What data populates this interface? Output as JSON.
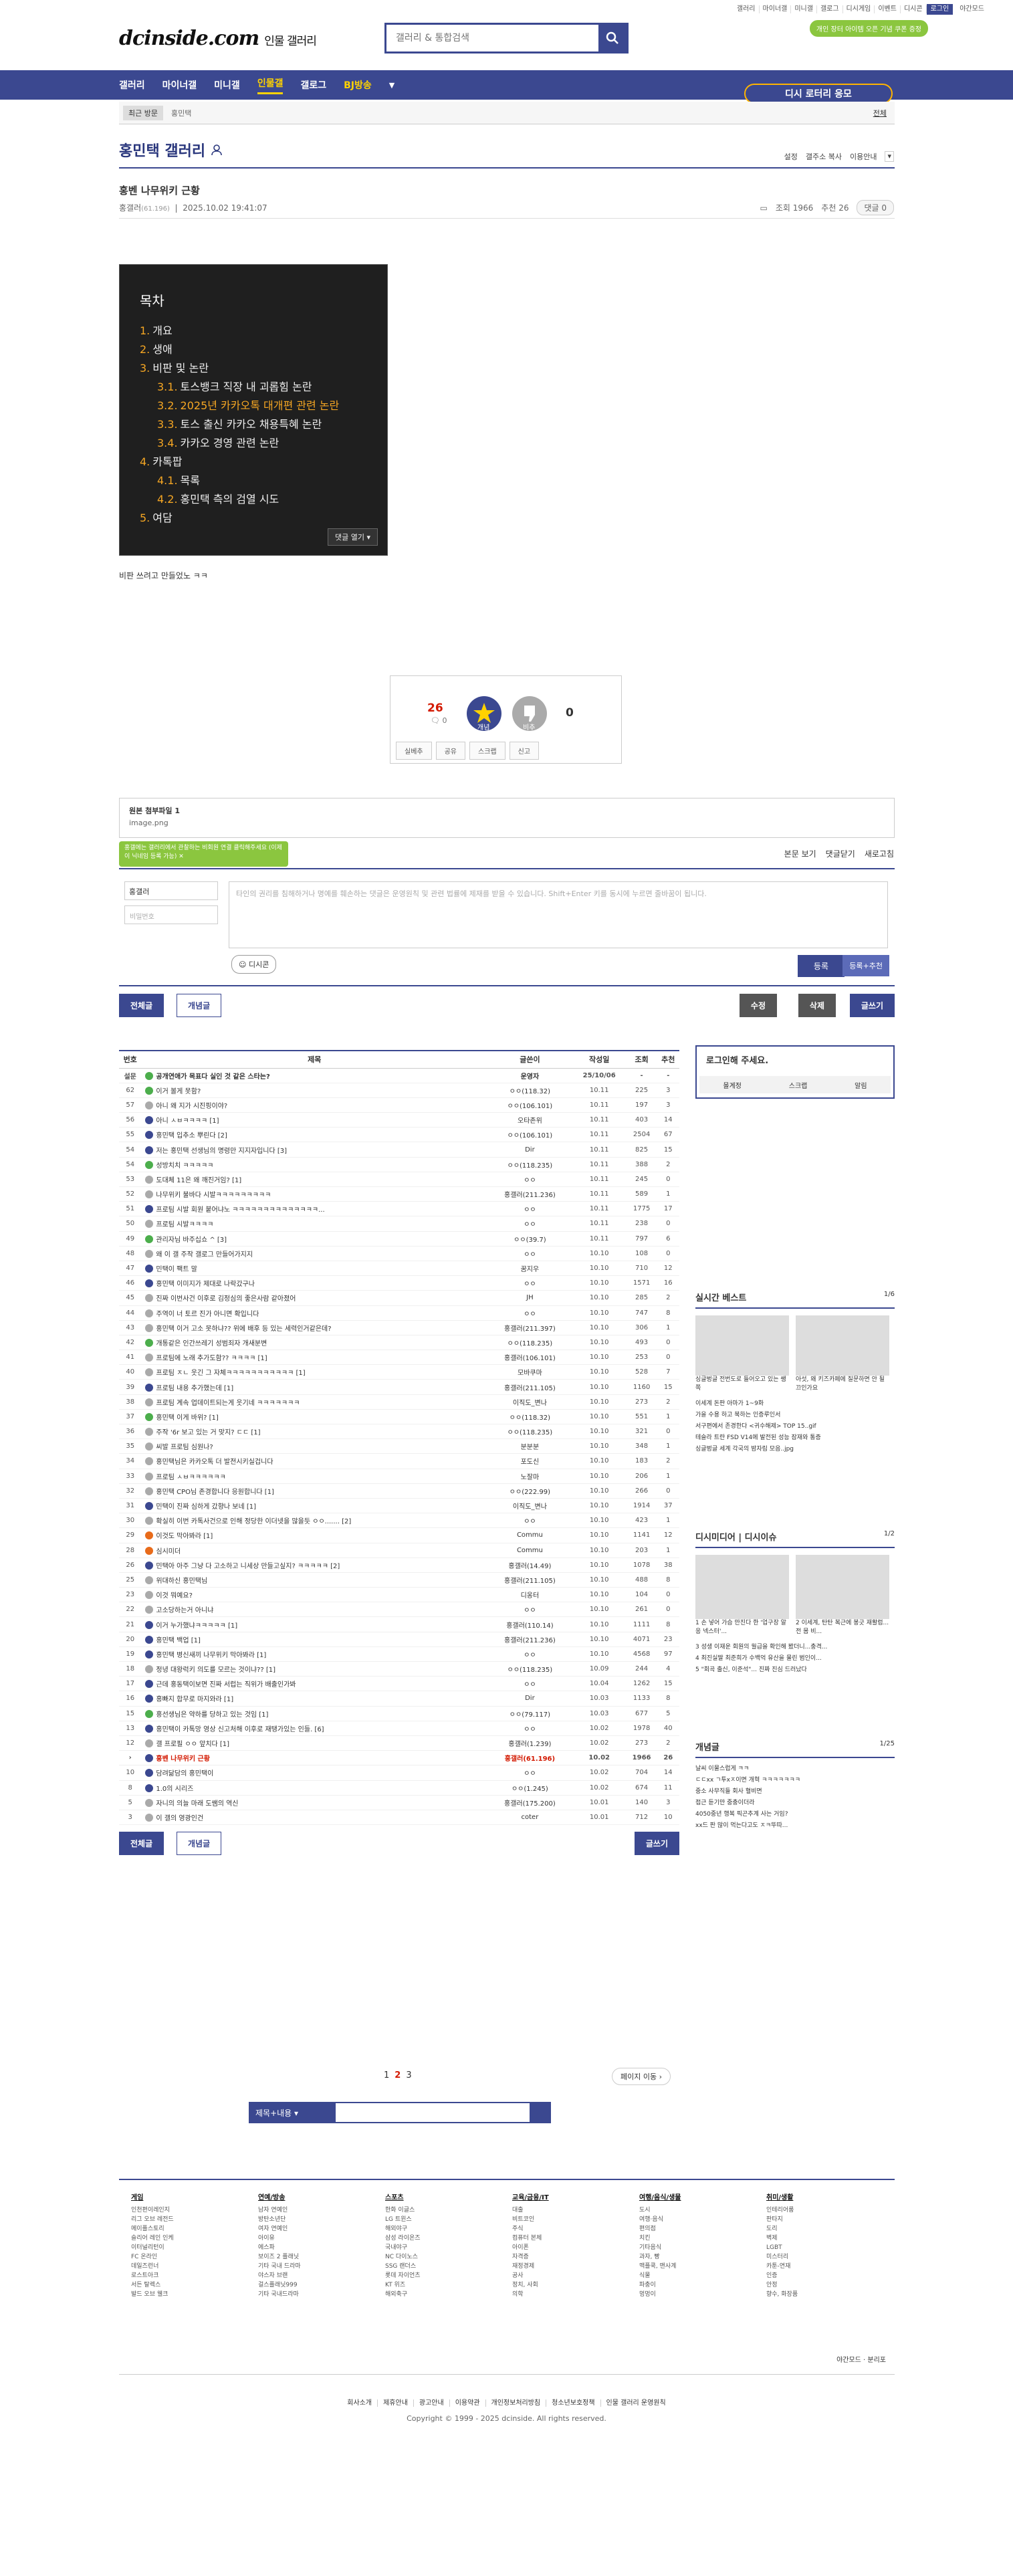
{
  "util": [
    "갤러리",
    "마이너갤",
    "미니갤",
    "갤로그",
    "디시게임",
    "이벤트",
    "디시콘",
    "로그인",
    "야간모드"
  ],
  "logo": {
    "main": "dcinside.com",
    "sub": "인물 갤러리"
  },
  "search": {
    "placeholder": "갤러리 & 통합검색"
  },
  "promo": "개인 장터 아이템 오픈 기념 쿠폰 증정",
  "nav": [
    "갤러리",
    "마이너갤",
    "미니갤",
    "인물갤",
    "갤로그",
    "BJ방송"
  ],
  "dcsi": "디시 로터리 응모",
  "recent": {
    "tag": "최근 방문",
    "item": "홍민택",
    "all": "전체"
  },
  "gallery": {
    "title": "홍민택 갤러리",
    "menu": [
      "설정",
      "갤주소 복사",
      "이용안내"
    ]
  },
  "post": {
    "title": "홍벤 나무위키 근황",
    "author": "홍갤러",
    "ip": "(61.196)",
    "date": "2025.10.02 19:41:07",
    "views": "조회 1966",
    "rec": "추천 26",
    "comments": "댓글 0"
  },
  "toc": {
    "title": "목차",
    "items": [
      {
        "n": "1.",
        "t": "개요",
        "l": 1
      },
      {
        "n": "2.",
        "t": "생애",
        "l": 1
      },
      {
        "n": "3.",
        "t": "비판 및 논란",
        "l": 1
      },
      {
        "n": "3.1.",
        "t": "토스뱅크 직장 내 괴롭힘 논란",
        "l": 2
      },
      {
        "n": "3.2.",
        "t": "2025년 카카오톡 대개편 관련 논란",
        "l": 2
      },
      {
        "n": "3.3.",
        "t": "토스 출신 카카오 채용특혜 논란",
        "l": 2
      },
      {
        "n": "3.4.",
        "t": "카카오 경영 관련 논란",
        "l": 2
      },
      {
        "n": "4.",
        "t": "카톡팝",
        "l": 1
      },
      {
        "n": "4.1.",
        "t": "목록",
        "l": 2
      },
      {
        "n": "4.2.",
        "t": "홍민택 측의 검열 시도",
        "l": 2
      },
      {
        "n": "5.",
        "t": "여담",
        "l": 1
      }
    ],
    "button": "댓글 열기"
  },
  "body": "비판 쓰려고 만들었노 ㅋㅋ",
  "vote": {
    "up": "26",
    "upsub": "0",
    "down": "0",
    "uplabel": "개념",
    "downlabel": "비추",
    "btns": [
      "실베추",
      "공유",
      "스크랩",
      "신고"
    ]
  },
  "attach": {
    "title": "원본 첨부파일 1",
    "file": "image.png"
  },
  "toast": "홍갤에는 갤러리에서 관찰하는 비회원 연결 클릭해주세요 (이제 이 닉네임 등록 가능)",
  "comment": {
    "bar": [
      "본문 보기",
      "댓글닫기",
      "새로고침"
    ],
    "user": "홍갤러",
    "pw": "비밀번호",
    "placeholder": "타인의 권리를 침해하거나 명예를 훼손하는 댓글은 운영원칙 및 관련 법률에 제재를 받을 수 있습니다. Shift+Enter 키를 동시에 누르면 줄바꿈이 됩니다.",
    "dccon": "디시콘",
    "submit": "등록",
    "submit2": "등록+추천"
  },
  "btns": {
    "all": "전체글",
    "best": "개념글",
    "edit": "수정",
    "del": "삭제",
    "write": "글쓰기"
  },
  "list": {
    "headers": [
      "번호",
      "제목",
      "글쓴이",
      "작성일",
      "조회",
      "추천"
    ],
    "rows": [
      {
        "no": "설문",
        "t": "공개연애가 목표다 실인 것 같은 스타는?",
        "w": "운영자",
        "d": "25/10/06",
        "v": "-",
        "r": "-",
        "ic": "g",
        "notice": true
      },
      {
        "no": "62",
        "t": "이거 볼게 못함?",
        "w": "ㅇㅇ(118.32)",
        "d": "10.11",
        "v": "225",
        "r": "3",
        "ic": "g"
      },
      {
        "no": "57",
        "t": "아니 왜 지가 시진핑이야?",
        "w": "ㅇㅇ(106.101)",
        "d": "10.11",
        "v": "197",
        "r": "3",
        "ic": "gr"
      },
      {
        "no": "56",
        "t": "아니 ㅅㅂㅋㅋㅋㅋ [1]",
        "w": "오타존위",
        "d": "10.11",
        "v": "403",
        "r": "14",
        "ic": "b"
      },
      {
        "no": "55",
        "t": "홍민택 입추소 뿌린다 [2]",
        "w": "ㅇㅇ(106.101)",
        "d": "10.11",
        "v": "2504",
        "r": "67",
        "ic": "b"
      },
      {
        "no": "54",
        "t": "저는 홍민택 선생님의 명령만 지지자입니다 [3]",
        "w": "Dir",
        "d": "10.11",
        "v": "825",
        "r": "15",
        "ic": "b"
      },
      {
        "no": "54",
        "t": "성방치치 ㅋㅋㅋㅋㅋ",
        "w": "ㅇㅇ(118.235)",
        "d": "10.11",
        "v": "388",
        "r": "2",
        "ic": "g"
      },
      {
        "no": "53",
        "t": "도대체 11은 왜 깨진거임? [1]",
        "w": "ㅇㅇ",
        "d": "10.11",
        "v": "245",
        "r": "0",
        "ic": "gr"
      },
      {
        "no": "52",
        "t": "나무위키 불바다 시발ㅋㅋㅋㅋㅋㅋㅋㅋㅋ",
        "w": "홍갤러(211.236)",
        "d": "10.11",
        "v": "589",
        "r": "1",
        "ic": "gr"
      },
      {
        "no": "51",
        "t": "프로팀 시발 회원 붙어냐노 ㅋㅋㅋㅋㅋㅋㅋㅋㅋㅋㅋㅋㅋㅋ...",
        "w": "ㅇㅇ",
        "d": "10.11",
        "v": "1775",
        "r": "17",
        "ic": "b"
      },
      {
        "no": "50",
        "t": "프로팀 시발ㅋㅋㅋㅋ",
        "w": "ㅇㅇ",
        "d": "10.11",
        "v": "238",
        "r": "0",
        "ic": "gr"
      },
      {
        "no": "49",
        "t": "관리자님 바주십쇼 ^ [3]",
        "w": "ㅇㅇ(39.7)",
        "d": "10.11",
        "v": "797",
        "r": "6",
        "ic": "g"
      },
      {
        "no": "48",
        "t": "왜 이 갤 주작 갤로그 만들어가지지",
        "w": "ㅇㅇ",
        "d": "10.10",
        "v": "108",
        "r": "0",
        "ic": "gr"
      },
      {
        "no": "47",
        "t": "민택이 팩트 말",
        "w": "꿈지우",
        "d": "10.10",
        "v": "710",
        "r": "12",
        "ic": "b"
      },
      {
        "no": "46",
        "t": "홍민택 이미지가 제대로 나락갔구나",
        "w": "ㅇㅇ",
        "d": "10.10",
        "v": "1571",
        "r": "16",
        "ic": "b"
      },
      {
        "no": "45",
        "t": "진짜 이번사건 이후로 김정심의 좋은사람 같아졌어",
        "w": "JH",
        "d": "10.10",
        "v": "285",
        "r": "2",
        "ic": "gr"
      },
      {
        "no": "44",
        "t": "주역이 너 토르 진가 아니면 확입니다",
        "w": "ㅇㅇ",
        "d": "10.10",
        "v": "747",
        "r": "8",
        "ic": "gr"
      },
      {
        "no": "43",
        "t": "홍민택 이거 고소 못하냐?? 위에 배후 등 있는 세력인거같은데?",
        "w": "홍갤러(211.397)",
        "d": "10.10",
        "v": "306",
        "r": "1",
        "ic": "gr"
      },
      {
        "no": "42",
        "t": "개통같은 인간쓰레기 성범죄자 개새분변",
        "w": "ㅇㅇ(118.235)",
        "d": "10.10",
        "v": "493",
        "r": "0",
        "ic": "g"
      },
      {
        "no": "41",
        "t": "프로팀에 노래 추가도함?? ㅋㅋㅋㅋ [1]",
        "w": "홍갤러(106.101)",
        "d": "10.10",
        "v": "253",
        "r": "0",
        "ic": "gr"
      },
      {
        "no": "40",
        "t": "프로팀 ㅈㄴ 웃긴 그 자체ㅋㅋㅋㅋㅋㅋㅋㅋㅋㅋㅋ [1]",
        "w": "모바쿠마",
        "d": "10.10",
        "v": "528",
        "r": "7",
        "ic": "gr"
      },
      {
        "no": "39",
        "t": "프로팀 내용 추가했는데 [1]",
        "w": "홍갤러(211.105)",
        "d": "10.10",
        "v": "1160",
        "r": "15",
        "ic": "b"
      },
      {
        "no": "38",
        "t": "프로팀 계속 업데이트되는게 웃기네 ㅋㅋㅋㅋㅋㅋㅋ",
        "w": "이직도_변나",
        "d": "10.10",
        "v": "273",
        "r": "2",
        "ic": "gr"
      },
      {
        "no": "37",
        "t": "홍민택 이게 바위? [1]",
        "w": "ㅇㅇ(118.32)",
        "d": "10.10",
        "v": "551",
        "r": "1",
        "ic": "g"
      },
      {
        "no": "36",
        "t": "주작 '6r 보고 있는 거 맞지? ㄷㄷ [1]",
        "w": "ㅇㅇ(118.235)",
        "d": "10.10",
        "v": "321",
        "r": "0",
        "ic": "gr"
      },
      {
        "no": "35",
        "t": "씨발 프로팀 심원나?",
        "w": "분분분",
        "d": "10.10",
        "v": "348",
        "r": "1",
        "ic": "gr"
      },
      {
        "no": "34",
        "t": "홍민택님은 카카오톡 더 발전시키실겁니다",
        "w": "포도신",
        "d": "10.10",
        "v": "183",
        "r": "2",
        "ic": "gr"
      },
      {
        "no": "33",
        "t": "프로팀 ㅅㅂㅋㅋㅋㅋㅋㅋ",
        "w": "노잘마",
        "d": "10.10",
        "v": "206",
        "r": "1",
        "ic": "gr"
      },
      {
        "no": "32",
        "t": "홍민택 CPO님 존경합니다 응원합니다 [1]",
        "w": "ㅇㅇ(222.99)",
        "d": "10.10",
        "v": "266",
        "r": "0",
        "ic": "gr"
      },
      {
        "no": "31",
        "t": "민택이 진짜 심하게 갔향나 보네 [1]",
        "w": "이직도_변나",
        "d": "10.10",
        "v": "1914",
        "r": "37",
        "ic": "b"
      },
      {
        "no": "30",
        "t": "확실히 이번 카톡사건으로 인해 정당한 이더넷을 많을듯 ㅇㅇ....... [2]",
        "w": "ㅇㅇ",
        "d": "10.10",
        "v": "423",
        "r": "1",
        "ic": "gr"
      },
      {
        "no": "29",
        "t": "이것도 막아봐라 [1]",
        "w": "Commu",
        "d": "10.10",
        "v": "1141",
        "r": "12",
        "ic": "r"
      },
      {
        "no": "28",
        "t": "심시미더",
        "w": "Commu",
        "d": "10.10",
        "v": "203",
        "r": "1",
        "ic": "r"
      },
      {
        "no": "26",
        "t": "민택아 아주 그냥 다 고소하고 니세상 만들고싶지? ㅋㅋㅋㅋㅋ [2]",
        "w": "홍갤러(14.49)",
        "d": "10.10",
        "v": "1078",
        "r": "38",
        "ic": "b"
      },
      {
        "no": "25",
        "t": "위대하신 홍민택님",
        "w": "홍갤러(211.105)",
        "d": "10.10",
        "v": "488",
        "r": "8",
        "ic": "gr"
      },
      {
        "no": "23",
        "t": "이것 뭐예요?",
        "w": "디옹터",
        "d": "10.10",
        "v": "104",
        "r": "0",
        "ic": "gr"
      },
      {
        "no": "22",
        "t": "고소당하는거 아니냐",
        "w": "ㅇㅇ",
        "d": "10.10",
        "v": "261",
        "r": "0",
        "ic": "gr"
      },
      {
        "no": "21",
        "t": "이거 누가했냐ㅋㅋㅋㅋㅋ [1]",
        "w": "홍갤러(110.14)",
        "d": "10.10",
        "v": "1111",
        "r": "8",
        "ic": "b"
      },
      {
        "no": "20",
        "t": "홍민택 백업 [1]",
        "w": "홍갤러(211.236)",
        "d": "10.10",
        "v": "4071",
        "r": "23",
        "ic": "b"
      },
      {
        "no": "19",
        "t": "홍민택 병신새끼 나무위키 막아봐라 [1]",
        "w": "ㅇㅇ",
        "d": "10.10",
        "v": "4568",
        "r": "97",
        "ic": "b"
      },
      {
        "no": "18",
        "t": "정녕 대왕럭키 의도를 모르는 것이냐?? [1]",
        "w": "ㅇㅇ(118.235)",
        "d": "10.09",
        "v": "244",
        "r": "4",
        "ic": "gr"
      },
      {
        "no": "17",
        "t": "근데 홍동택이보면 진짜 서럽는 직위가 배출인가봐",
        "w": "ㅇㅇ",
        "d": "10.04",
        "v": "1262",
        "r": "15",
        "ic": "b"
      },
      {
        "no": "16",
        "t": "홍빠지 합무로 마지와라 [1]",
        "w": "Dir",
        "d": "10.03",
        "v": "1133",
        "r": "8",
        "ic": "b"
      },
      {
        "no": "15",
        "t": "홍선생님은 약하를 당하고 있는 것임 [1]",
        "w": "ㅇㅇ(79.117)",
        "d": "10.03",
        "v": "677",
        "r": "5",
        "ic": "g"
      },
      {
        "no": "13",
        "t": "홍민택이 카톡망 영상 신고처해 이후로 재탱가있는 인들. [6]",
        "w": "ㅇㅇ",
        "d": "10.02",
        "v": "1978",
        "r": "40",
        "ic": "b"
      },
      {
        "no": "12",
        "t": "갤 프로필 ㅇㅇ 앞치다 [1]",
        "w": "홍갤러(1.239)",
        "d": "10.02",
        "v": "273",
        "r": "2",
        "ic": "gr"
      },
      {
        "no": "›",
        "t": "홍벤 나무위키 근황",
        "w": "홍갤러(61.196)",
        "d": "10.02",
        "v": "1966",
        "r": "26",
        "ic": "b",
        "cur": true
      },
      {
        "no": "10",
        "t": "담려닮담의 홍민택이",
        "w": "ㅇㅇ",
        "d": "10.02",
        "v": "704",
        "r": "14",
        "ic": "b"
      },
      {
        "no": "8",
        "t": "1.0의 시리즈",
        "w": "ㅇㅇ(1.245)",
        "d": "10.02",
        "v": "674",
        "r": "11",
        "ic": "b"
      },
      {
        "no": "5",
        "t": "자니의 의늘 마래 도쌤의 역신",
        "w": "홍갤러(175.200)",
        "d": "10.01",
        "v": "140",
        "r": "3",
        "ic": "gr"
      },
      {
        "no": "3",
        "t": "이 갤의 영광인건",
        "w": "coter",
        "d": "10.01",
        "v": "712",
        "r": "10",
        "ic": "gr"
      }
    ]
  },
  "pages": [
    "1",
    "2",
    "3"
  ],
  "pagemove": "페이지 이동",
  "searchsel": "제목+내용",
  "side": {
    "login": "로그인해 주세요.",
    "loginbtns": [
      "몰계정",
      "스크랩",
      "알림"
    ],
    "best": {
      "title": "실시간 베스트",
      "page": "1/6",
      "caps": [
        "싱글벙글 전번도로 들어오고 있는 쌩쪽",
        "아섯, 왜 키즈카페에 질문하면 안 될끄인가요"
      ],
      "items": [
        "이세계 돈판 아마가 1~9화",
        "가을 수용 하고 북하는 인증루인서",
        "서구편에서 존경한다 <귀수해제> TOP 15..gif",
        "테슬라 트란 FSD V14에 발전된 성능 잠재와 통증",
        "싱글벙글 세계 각국의 밤자림 모음..jpg"
      ]
    },
    "dcmedia": {
      "title": "디시미디어 | 디시이슈",
      "page": "1/2",
      "caps": [
        "1 손 넣어 가슴 만진다 한 '업구장 알응 넥스터'...",
        "2 이세계, 탄탄 복근에 봉긋 재활럼... 전 몸 비..."
      ],
      "items": [
        "3 성생 이재운 회원의 월급을 확인해 봤더니...충격...",
        "4 최진실딸 최준희가 수백억 유산을 물린 범인이...",
        "5 \"회곡 출신, 이준석\"... 진짜 진심 드러났다"
      ]
    },
    "concept": {
      "title": "개념글",
      "page": "1/25",
      "items": [
        "날씨 이물스럽게 ㅋㅋ",
        "ㄷㄷxx ㄱ투xㅈ이면 개혁 ㅋㅋㅋㅋㅋㅋㅋ",
        "중소 사무직들 회사 혈비면",
        "접근 듣기만 중충이더라",
        "4050중년 행복 픽곤추계 사는 거임?",
        "xx드 판 많이 먹는다고도 ㅈㅋ뚜따..."
      ]
    }
  },
  "footer": {
    "cols": [
      {
        "h": "게임",
        "items": [
          "인천편이레인지",
          "리그 오브 레전드",
          "메이플스토리",
          "슬리어 레인 인케",
          "이터널리턴이",
          "FC 온라인",
          "데일즈런너",
          "로스트아크",
          "서든 탈렉스",
          "발드 오브 웰크"
        ]
      },
      {
        "h": "연예/방송",
        "items": [
          "남자 연예인",
          "방탄소년단",
          "여자 연예인",
          "아이유",
          "에스파",
          "보이즈 2 플래닛",
          "기타 국내 드라마",
          "야스자 브랜",
          "걸스플래닛999",
          "기타 국내드라마"
        ]
      },
      {
        "h": "스포츠",
        "items": [
          "한화 이글스",
          "LG 트윈스",
          "해외야구",
          "삼성 라이온즈",
          "국내야구",
          "NC 다이노스",
          "SSG 랜더스",
          "롯데 자이언츠",
          "KT 위즈",
          "해외축구"
        ]
      },
      {
        "h": "교육/금융/IT",
        "items": [
          "대출",
          "비트코인",
          "주식",
          "컴퓨터 본체",
          "아이폰",
          "자격증",
          "재정경제",
          "공사",
          "정치, 사회",
          "의학"
        ]
      },
      {
        "h": "여행/음식/생물",
        "items": [
          "도시",
          "여행·음식",
          "편의점",
          "치킨",
          "기타음식",
          "과자, 빵",
          "맥플쿡, 맨사계",
          "식물",
          "파충이",
          "멍멍이"
        ]
      },
      {
        "h": "취미/생활",
        "items": [
          "인테리어룸",
          "판타지",
          "도리",
          "벽제",
          "LGBT",
          "미스터리",
          "카툰-연재",
          "인증",
          "안정",
          "향수, 화장품"
        ]
      }
    ],
    "mode": "야간모드 · 분리포",
    "links": [
      "회사소개",
      "제휴안내",
      "광고안내",
      "이용약관",
      "개인정보처리방침",
      "청소년보호정책",
      "인물 갤러리 운영원칙"
    ],
    "copy": "Copyright © 1999 - 2025 dcinside. All rights reserved."
  }
}
